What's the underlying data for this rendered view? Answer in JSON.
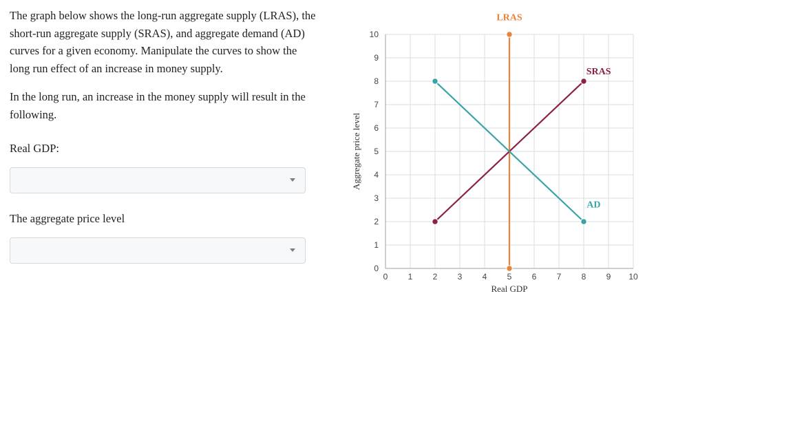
{
  "question": {
    "p1": "The graph below shows the long-run aggregate supply (LRAS), the short-run aggregate supply (SRAS), and aggregate demand (AD) curves for a given economy. Manipulate the curves to show the long run effect of an increase in money supply.",
    "p2": "In the long run, an increase in the money supply will result in the following.",
    "label_gdp": "Real GDP:",
    "label_price": "The aggregate price level",
    "dropdown_gdp_value": "",
    "dropdown_price_value": ""
  },
  "chart_data": {
    "type": "line",
    "xlabel": "Real GDP",
    "ylabel": "Aggregate price level",
    "xlim": [
      0,
      10
    ],
    "ylim": [
      0,
      10
    ],
    "xticks": [
      0,
      1,
      2,
      3,
      4,
      5,
      6,
      7,
      8,
      9,
      10
    ],
    "yticks": [
      0,
      1,
      2,
      3,
      4,
      5,
      6,
      7,
      8,
      9,
      10
    ],
    "series": [
      {
        "name": "LRAS",
        "color": "#e8833a",
        "label_pos": {
          "x": 5,
          "y": 10.6
        },
        "points": [
          {
            "x": 5,
            "y": 0
          },
          {
            "x": 5,
            "y": 10
          }
        ],
        "endpoints_dots": [
          {
            "x": 5,
            "y": 0
          },
          {
            "x": 5,
            "y": 10
          }
        ]
      },
      {
        "name": "SRAS",
        "color": "#8a2146",
        "label_pos": {
          "x": 8.6,
          "y": 8.3
        },
        "points": [
          {
            "x": 2,
            "y": 2
          },
          {
            "x": 8,
            "y": 8
          }
        ],
        "endpoints_dots": [
          {
            "x": 2,
            "y": 2
          },
          {
            "x": 8,
            "y": 8
          }
        ]
      },
      {
        "name": "AD",
        "color": "#3aa3a8",
        "label_pos": {
          "x": 8.4,
          "y": 2.6
        },
        "points": [
          {
            "x": 2,
            "y": 8
          },
          {
            "x": 8,
            "y": 2
          }
        ],
        "endpoints_dots": [
          {
            "x": 2,
            "y": 8
          },
          {
            "x": 8,
            "y": 2
          }
        ]
      }
    ]
  }
}
